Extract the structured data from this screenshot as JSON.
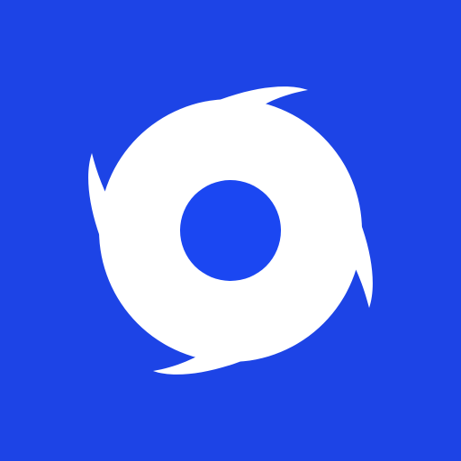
{
  "icon": {
    "name": "hurricane-icon",
    "background_color": "#1d44e6",
    "glyph_color": "#ffffff",
    "eye_color": "#1b47f2"
  }
}
